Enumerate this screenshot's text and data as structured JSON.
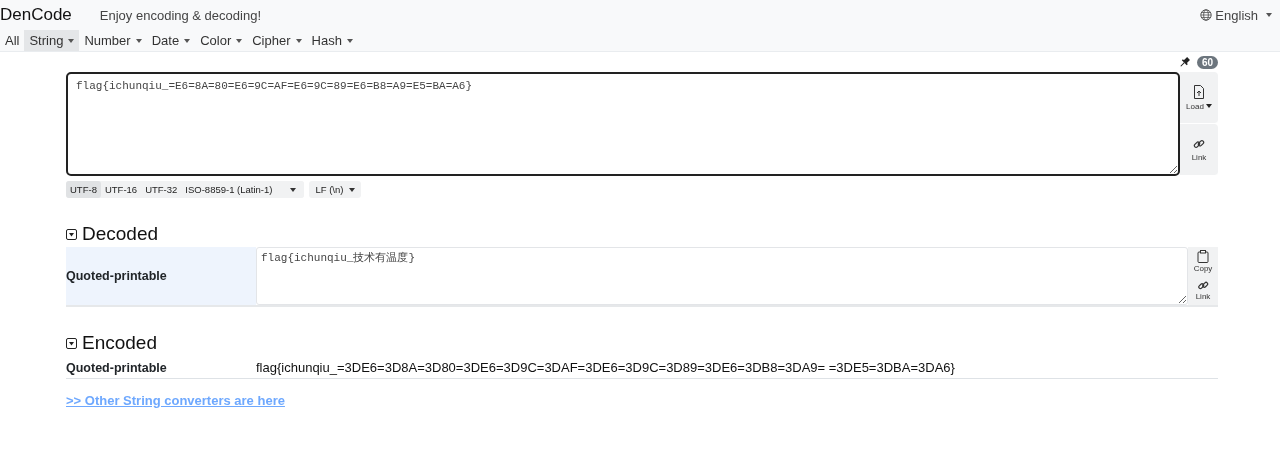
{
  "header": {
    "brand": "DenCode",
    "tagline": "Enjoy encoding & decoding!",
    "language": "English"
  },
  "nav": [
    {
      "label": "All",
      "selected": false,
      "dropdown": false
    },
    {
      "label": "String",
      "selected": true,
      "dropdown": true
    },
    {
      "label": "Number",
      "selected": false,
      "dropdown": true
    },
    {
      "label": "Date",
      "selected": false,
      "dropdown": true
    },
    {
      "label": "Color",
      "selected": false,
      "dropdown": true
    },
    {
      "label": "Cipher",
      "selected": false,
      "dropdown": true
    },
    {
      "label": "Hash",
      "selected": false,
      "dropdown": true
    }
  ],
  "input": {
    "value": "flag{ichunqiu_=E6=8A=80=E6=9C=AF=E6=9C=89=E6=B8=A9=E5=BA=A6}",
    "length_badge": "60",
    "load_button": "Load",
    "link_button": "Link"
  },
  "encodings": [
    {
      "label": "UTF-8",
      "selected": true
    },
    {
      "label": "UTF-16",
      "selected": false
    },
    {
      "label": "UTF-32",
      "selected": false
    },
    {
      "label": "ISO-8859-1 (Latin-1)",
      "selected": false
    }
  ],
  "line_break": "LF (\\n)",
  "decoded": {
    "title": "Decoded",
    "expanded": true,
    "rows": [
      {
        "label": "Quoted-printable",
        "value": "flag{ichunqiu_技术有温度}",
        "copy_button": "Copy",
        "link_button": "Link"
      }
    ]
  },
  "encoded": {
    "title": "Encoded",
    "expanded": true,
    "rows": [
      {
        "label": "Quoted-printable",
        "value": "flag{ichunqiu_=3DE6=3D8A=3D80=3DE6=3D9C=3DAF=3DE6=3D9C=3D89=3DE6=3DB8=3DA9= =3DE5=3DBA=3DA6}"
      }
    ]
  },
  "more_link": ">> Other String converters are here"
}
